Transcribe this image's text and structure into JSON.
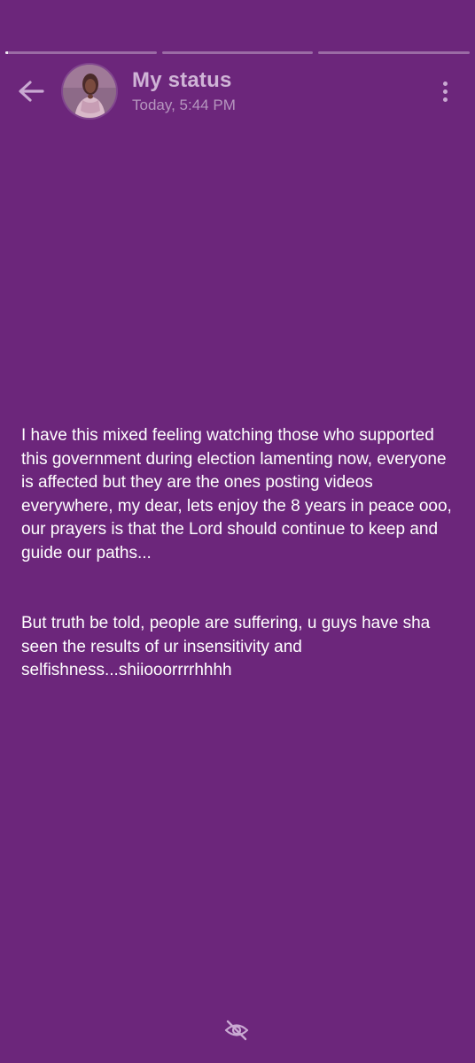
{
  "progress": {
    "segments": [
      0.02,
      0,
      0
    ]
  },
  "header": {
    "title": "My status",
    "timestamp": "Today, 5:44 PM",
    "back_icon": "arrow-left-icon",
    "menu_icon": "more-vertical-icon"
  },
  "status": {
    "paragraph_1": "I have this mixed feeling watching those who supported this government during election lamenting now, everyone is affected but they are the ones posting videos everywhere, my dear, lets enjoy the 8 years in peace ooo, our prayers is that the Lord should continue to keep and guide our paths...",
    "paragraph_2": "But truth be told, people are suffering, u guys have sha seen the results of ur insensitivity and selfishness...shiiooorrrrhhhh"
  },
  "footer": {
    "icon": "eye-off-icon"
  },
  "colors": {
    "background": "#6c267b",
    "title": "#cfb4d6",
    "subtitle": "#b696bf"
  }
}
